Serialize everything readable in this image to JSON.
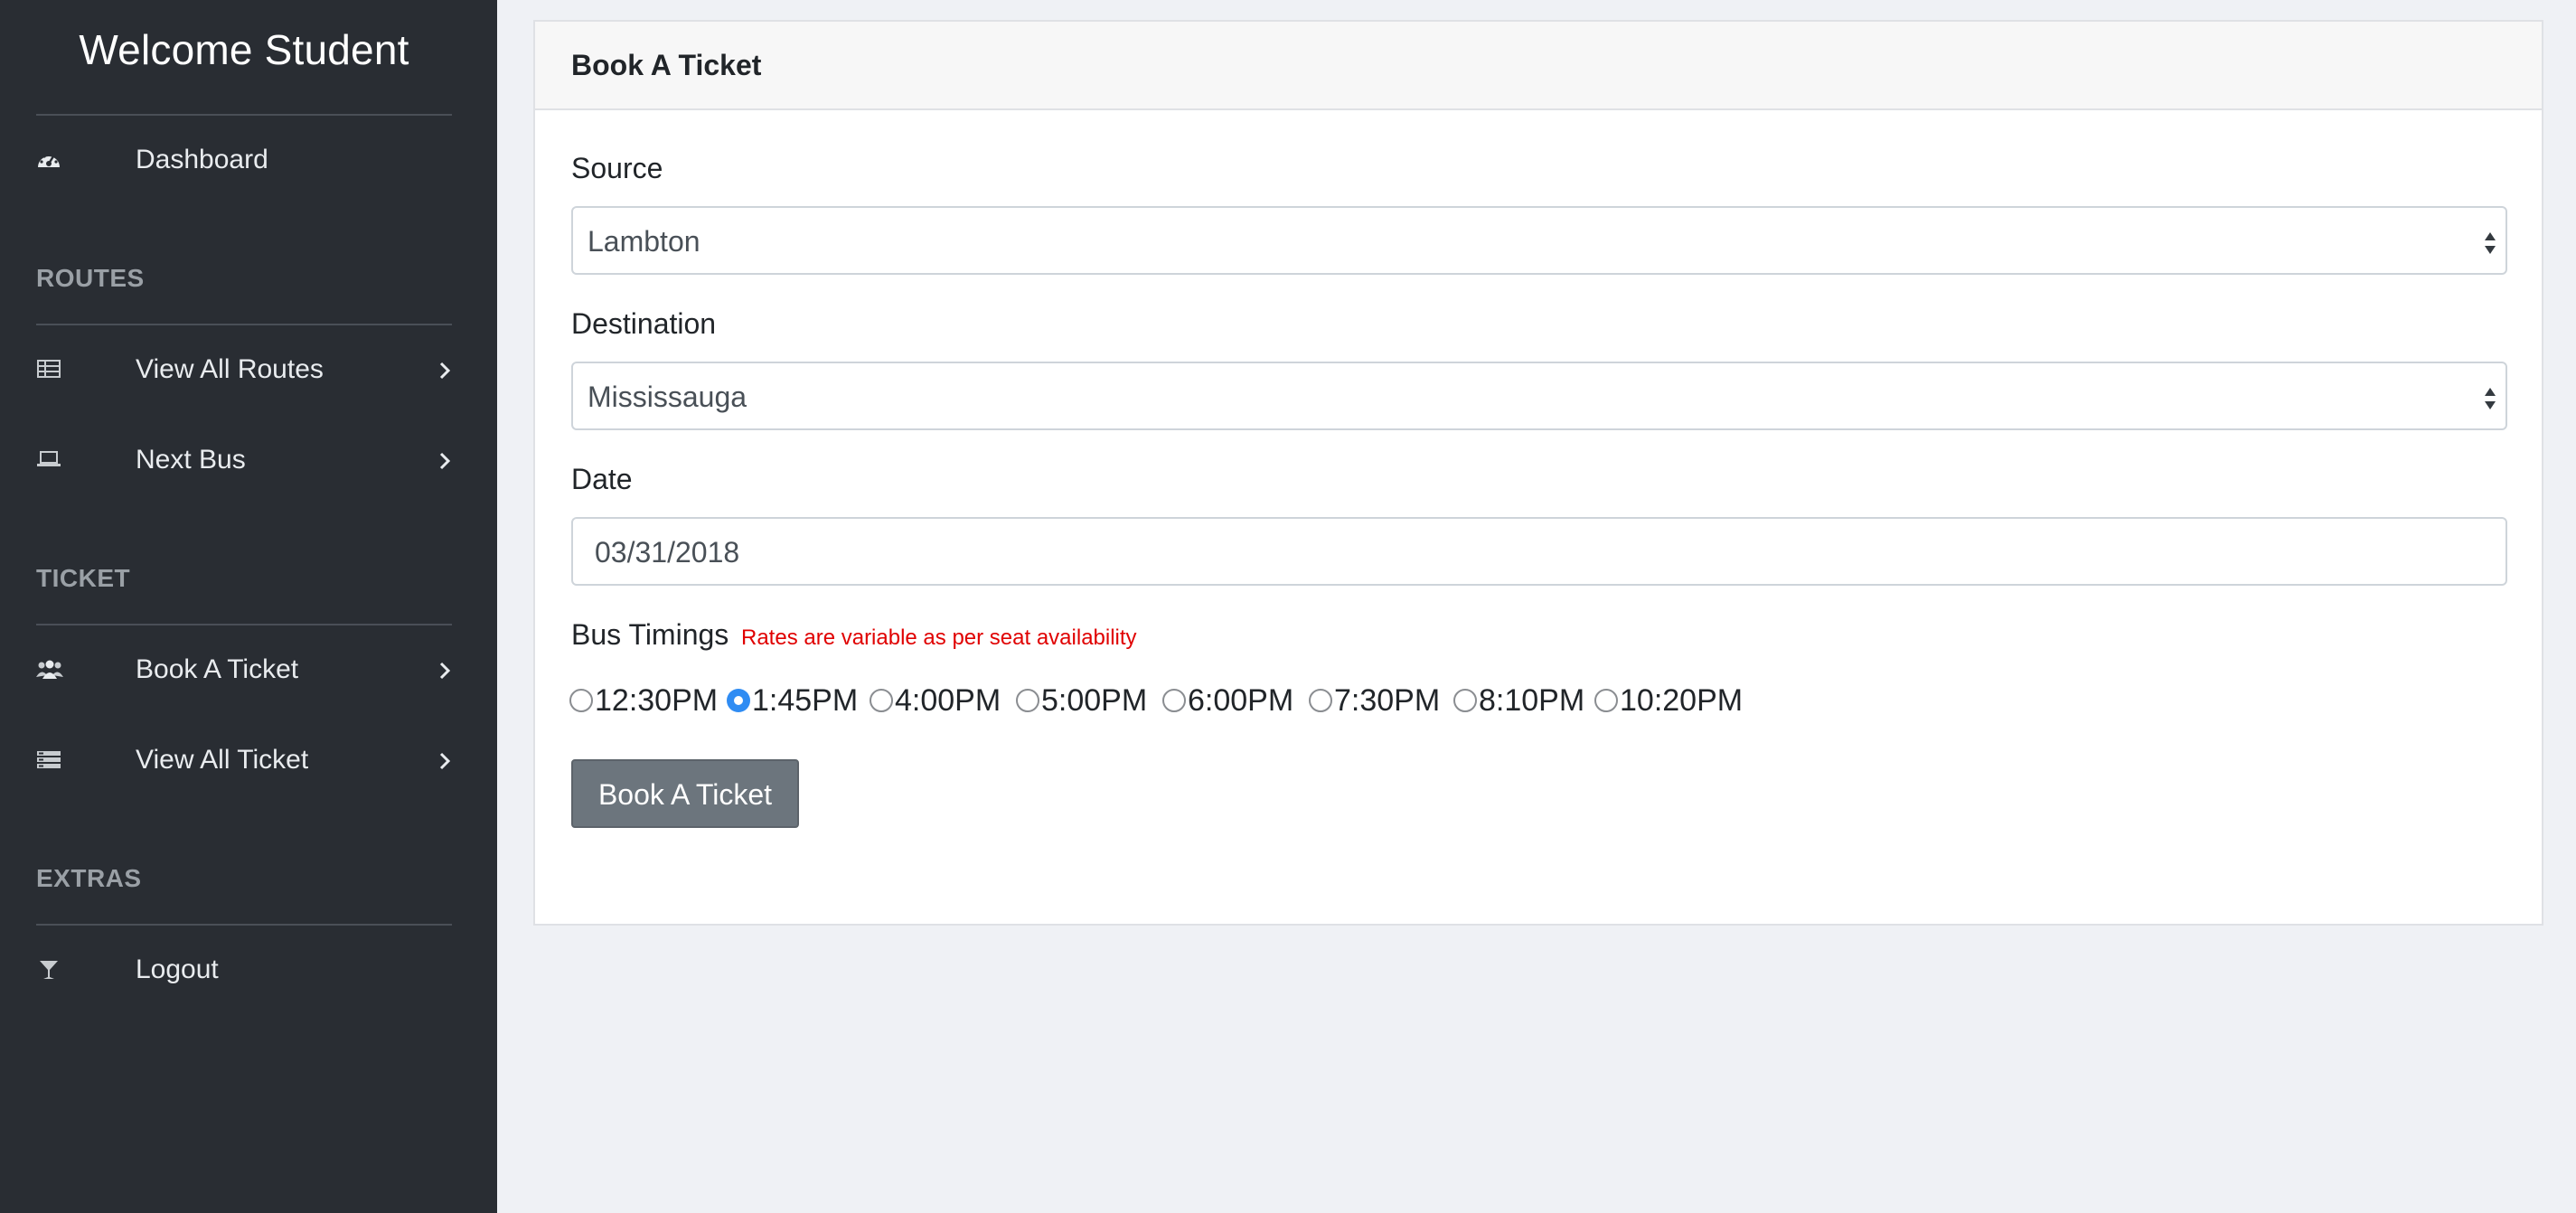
{
  "sidebar": {
    "title": "Welcome Student",
    "dashboard": {
      "label": "Dashboard",
      "icon": "dashboard-icon"
    },
    "sections": {
      "routes": "ROUTES",
      "ticket": "TICKET",
      "extras": "EXTRAS"
    },
    "routes_items": [
      {
        "label": "View All Routes",
        "icon": "table-icon"
      },
      {
        "label": "Next Bus",
        "icon": "laptop-icon"
      }
    ],
    "ticket_items": [
      {
        "label": "Book A Ticket",
        "icon": "users-icon"
      },
      {
        "label": "View All Ticket",
        "icon": "list-icon"
      }
    ],
    "extras_items": [
      {
        "label": "Logout",
        "icon": "glass-icon"
      }
    ]
  },
  "card": {
    "title": "Book A Ticket"
  },
  "form": {
    "source": {
      "label": "Source",
      "value": "Lambton"
    },
    "destination": {
      "label": "Destination",
      "value": "Mississauga"
    },
    "date": {
      "label": "Date",
      "value": "03/31/2018"
    },
    "timings": {
      "label": "Bus Timings",
      "note": "Rates are variable as per seat availability",
      "options": [
        "12:30PM",
        "1:45PM",
        "4:00PM",
        "5:00PM",
        "6:00PM",
        "7:30PM",
        "8:10PM",
        "10:20PM"
      ],
      "selected": "1:45PM"
    },
    "submit_label": "Book A Ticket"
  },
  "colors": {
    "sidebar_bg": "#292d33",
    "page_bg": "#eff1f5",
    "note_red": "#e00000",
    "radio_selected": "#2f8cf3",
    "button_bg": "#6c757d"
  }
}
